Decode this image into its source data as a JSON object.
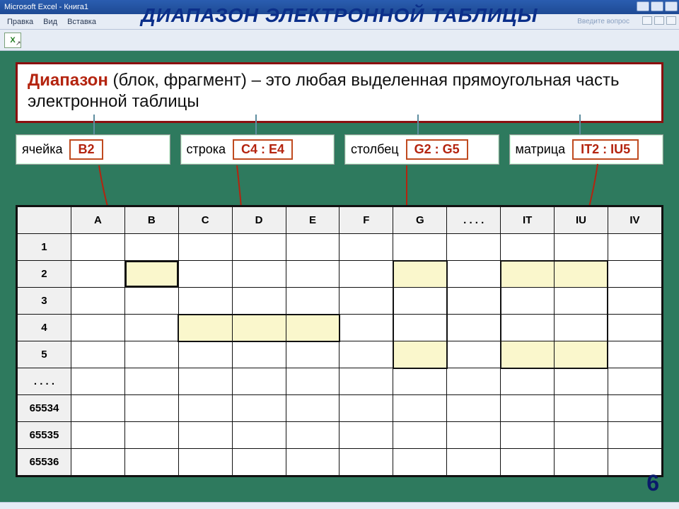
{
  "titlebar": {
    "app_title": "Microsoft Excel - Книга1"
  },
  "menubar": {
    "items": [
      "Правка",
      "Вид",
      "Вставка"
    ],
    "search_hint": "Введите вопрос"
  },
  "slide": {
    "title": "ДИАПАЗОН  ЭЛЕКТРОННОЙ  ТАБЛИЦЫ"
  },
  "definition": {
    "term": "Диапазон",
    "rest": " (блок, фрагмент) – это любая выделенная прямоугольная часть  электронной  таблицы"
  },
  "types": [
    {
      "label": "ячейка",
      "ref": "B2"
    },
    {
      "label": "строка",
      "ref": "C4 : E4"
    },
    {
      "label": "столбец",
      "ref": "G2 : G5"
    },
    {
      "label": "матрица",
      "ref": "IT2 : IU5"
    }
  ],
  "sheet": {
    "cols": [
      "A",
      "B",
      "C",
      "D",
      "E",
      "F",
      "G",
      ". . . .",
      "IT",
      "IU",
      "IV"
    ],
    "rows": [
      "1",
      "2",
      "3",
      "4",
      "5",
      ". . . .",
      "65534",
      "65535",
      "65536"
    ]
  },
  "page_number": "6",
  "icons": {
    "excel": "X",
    "shortcut": "↗"
  }
}
